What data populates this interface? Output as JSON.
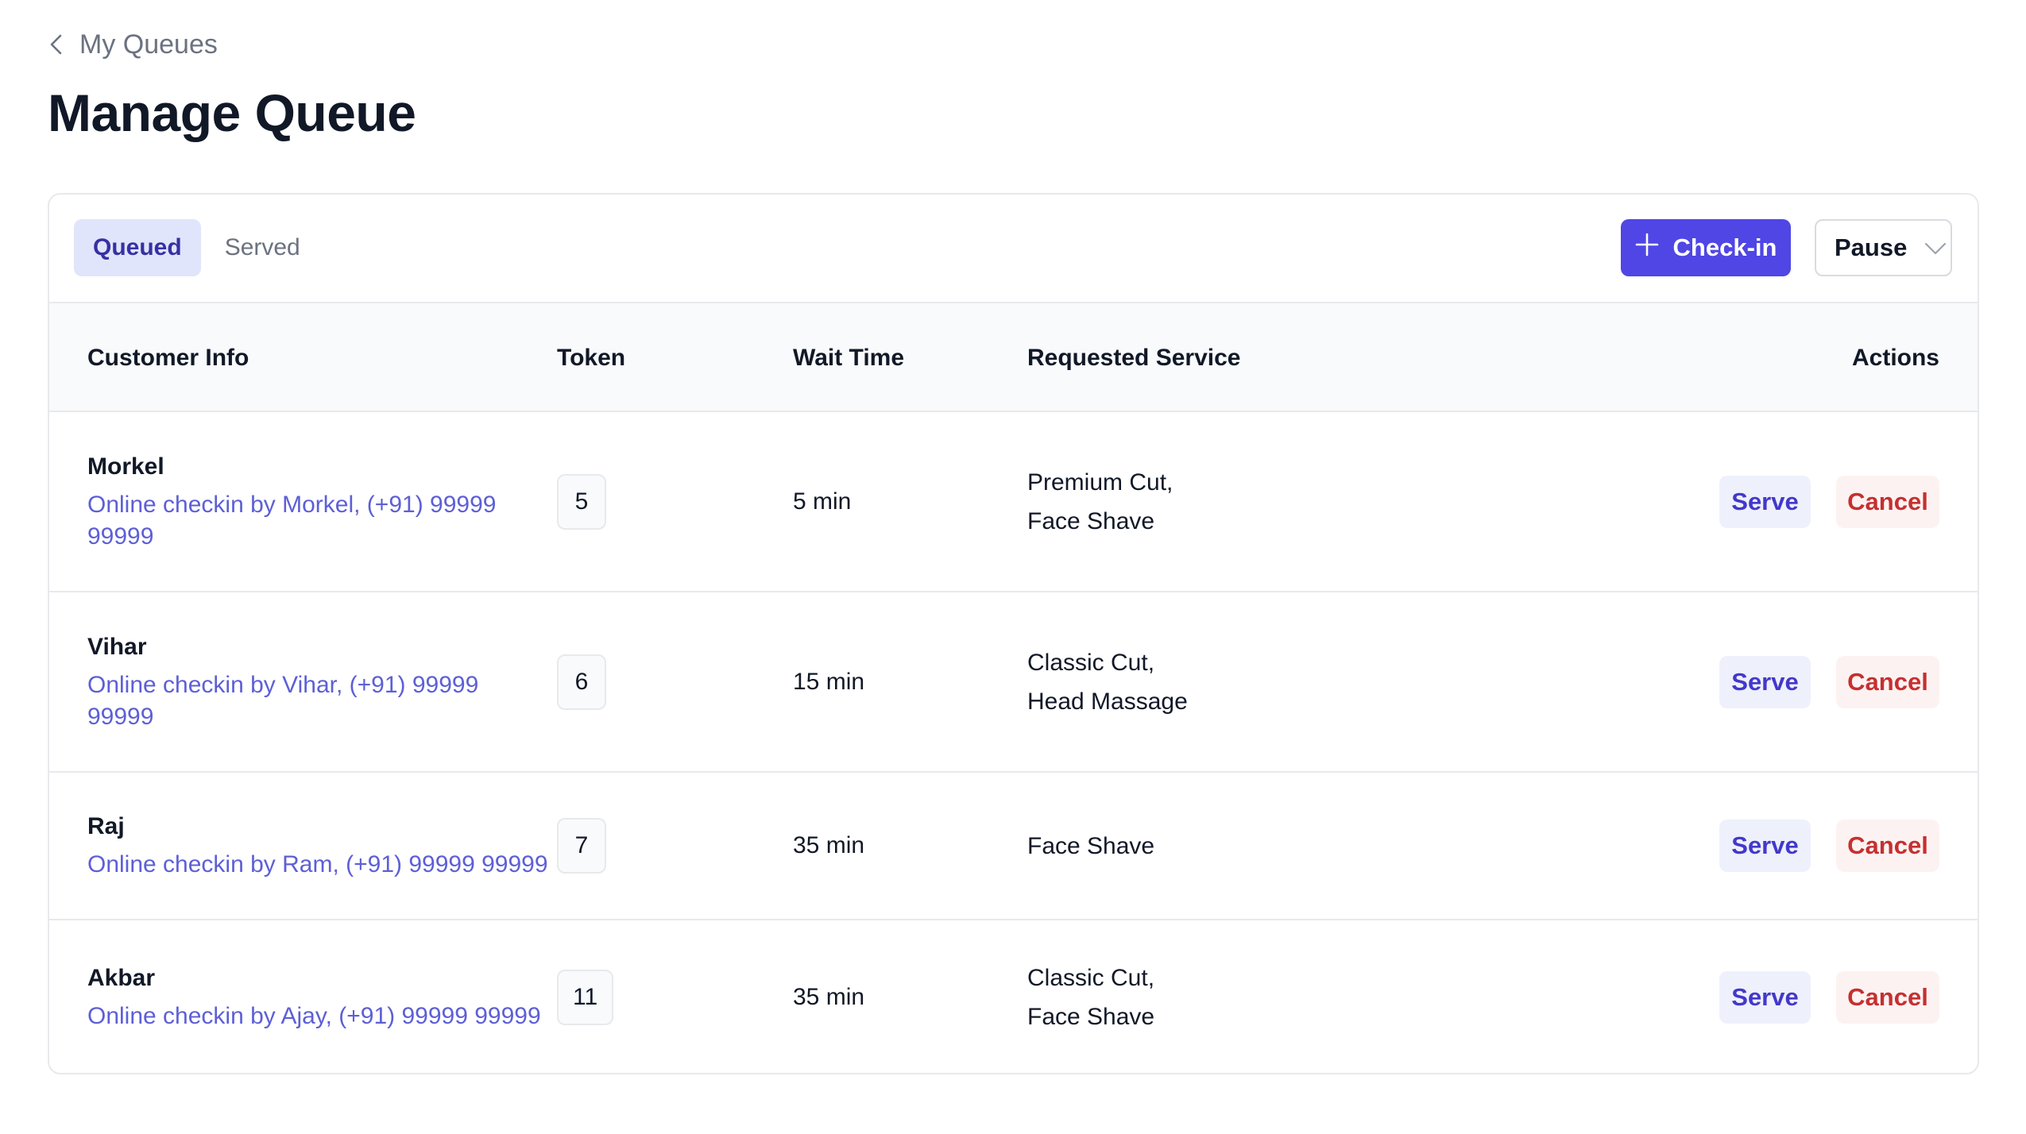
{
  "breadcrumb": {
    "label": "My Queues",
    "icon": "chevron-left-icon"
  },
  "page": {
    "title": "Manage Queue"
  },
  "toolbar": {
    "tabs": [
      {
        "label": "Queued",
        "active": true
      },
      {
        "label": "Served",
        "active": false
      }
    ],
    "checkin_label": "Check-in",
    "checkin_icon": "plus-icon",
    "pause_select": {
      "value": "Pause",
      "icon": "chevron-down-icon"
    }
  },
  "colors": {
    "accent": "#4f46e5",
    "active_tab_bg": "#e0e5fb",
    "link_text": "#5d5fd6",
    "serve_text": "#4338ca",
    "serve_bg": "#eef0fc",
    "cancel_text": "#c53030",
    "cancel_bg": "#fdf2f2"
  },
  "table": {
    "headers": {
      "customer": "Customer Info",
      "token": "Token",
      "wait": "Wait Time",
      "service": "Requested Service",
      "actions": "Actions"
    },
    "rows": [
      {
        "name": "Morkel",
        "detail": "Online checkin by Morkel, (+91) 99999 99999",
        "token": "5",
        "wait": "5 min",
        "services": [
          "Premium Cut,",
          "Face Shave"
        ],
        "serve_label": "Serve",
        "cancel_label": "Cancel"
      },
      {
        "name": "Vihar",
        "detail": "Online checkin by Vihar, (+91) 99999 99999",
        "token": "6",
        "wait": "15 min",
        "services": [
          "Classic Cut,",
          "Head Massage"
        ],
        "serve_label": "Serve",
        "cancel_label": "Cancel"
      },
      {
        "name": "Raj",
        "detail": "Online checkin by Ram, (+91) 99999 99999",
        "token": "7",
        "wait": "35 min",
        "services": [
          "Face Shave"
        ],
        "serve_label": "Serve",
        "cancel_label": "Cancel"
      },
      {
        "name": "Akbar",
        "detail": "Online checkin by Ajay, (+91) 99999 99999",
        "token": "11",
        "wait": "35 min",
        "services": [
          "Classic Cut,",
          "Face Shave"
        ],
        "serve_label": "Serve",
        "cancel_label": "Cancel"
      }
    ]
  }
}
